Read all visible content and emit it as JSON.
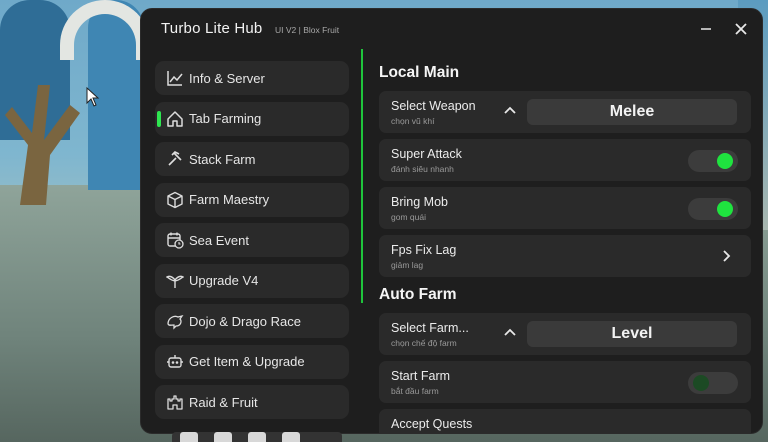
{
  "window": {
    "title": "Turbo Lite Hub",
    "subtitle": "UI V2 | Blox Fruit",
    "accent": "#1fe33f"
  },
  "sidebar": {
    "items": [
      {
        "label": "Info & Server",
        "icon": "chart-line-icon",
        "active": false
      },
      {
        "label": "Tab Farming",
        "icon": "home-icon",
        "active": true
      },
      {
        "label": "Stack Farm",
        "icon": "hammer-icon",
        "active": false
      },
      {
        "label": "Farm Maestry",
        "icon": "cube-icon",
        "active": false
      },
      {
        "label": "Sea Event",
        "icon": "calendar-clock-icon",
        "active": false
      },
      {
        "label": "Upgrade V4",
        "icon": "wings-icon",
        "active": false
      },
      {
        "label": "Dojo & Drago Race",
        "icon": "dragon-icon",
        "active": false
      },
      {
        "label": "Get Item & Upgrade",
        "icon": "robot-icon",
        "active": false
      },
      {
        "label": "Raid & Fruit",
        "icon": "castle-icon",
        "active": false
      }
    ]
  },
  "main": {
    "local_main": {
      "title": "Local Main",
      "select_weapon": {
        "name": "Select Weapon",
        "desc": "chọn vũ khí",
        "value": "Melee"
      },
      "super_attack": {
        "name": "Super Attack",
        "desc": "đánh siêu nhanh",
        "on": true
      },
      "bring_mob": {
        "name": "Bring Mob",
        "desc": "gom quái",
        "on": true
      },
      "fps_fix": {
        "name": "Fps Fix Lag",
        "desc": "giảm lag"
      }
    },
    "auto_farm": {
      "title": "Auto Farm",
      "select_farm": {
        "name": "Select Farm...",
        "desc": "chọn chế độ farm",
        "value": "Level"
      },
      "start_farm": {
        "name": "Start Farm",
        "desc": "bắt đầu farm",
        "on": false
      },
      "accept_quests": {
        "name": "Accept Quests"
      }
    }
  }
}
